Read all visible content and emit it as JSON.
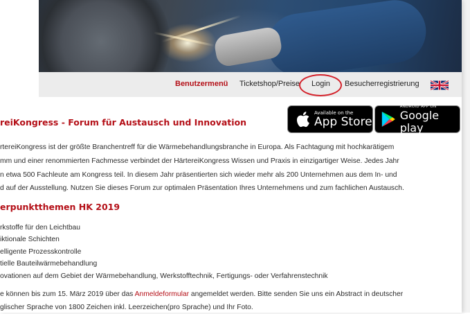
{
  "nav": {
    "items": [
      "Benutzermenü",
      "Ticketshop/Preise",
      "Login",
      "Besucherregistrierung"
    ],
    "active_color": "#b40f17",
    "highlight_color": "#d4212a",
    "language_icon": "uk-flag-icon"
  },
  "badges": {
    "apple_small": "Available on the",
    "apple_big": "App Store",
    "apple_icon": "apple-icon",
    "google_small": "ANDROID APP ON",
    "google_big": "Google play",
    "google_icon": "google-play-icon"
  },
  "content": {
    "title": "reiKongress - Forum für Austausch und Innovation",
    "paragraph": [
      "rtereiKongress ist der größte Branchentreff für die Wärmebehandlungsbranche in Europa. Als Fachtagung mit hochkarätigem",
      "mm und einer renommierten Fachmesse verbindet der HärtereiKongress Wissen und Praxis in einzigartiger Weise. Jedes Jahr",
      "n etwa 500 Fachleute am Kongress teil. In diesem Jahr präsentierten sich wieder mehr als 200 Unternehmen aus dem In- und",
      "d auf der Ausstellung. Nutzen Sie dieses Forum zur optimalen Präsentation Ihres Unternehmens und zum fachlichen Austausch."
    ],
    "subtitle": "erpunktthemen HK 2019",
    "topics": [
      "rkstoffe für den Leichtbau",
      "iktionale Schichten",
      "elligente Prozesskontrolle",
      "tielle Bauteilwärmebehandlung",
      "ovationen auf dem Gebiet der Wärmebehandlung, Werkstofftechnik, Fertigungs- oder Verfahrenstechnik"
    ],
    "footer_pre": "e können bis zum 15. März 2019 über das ",
    "footer_link": "Anmeldeformular",
    "footer_post": " angemeldet werden. Bitte senden Sie uns ein Abstract in deutscher",
    "footer_line2": "glischer Sprache von 1800 Zeichen inkl. Leerzeichen(pro Sprache) und Ihr Foto."
  }
}
